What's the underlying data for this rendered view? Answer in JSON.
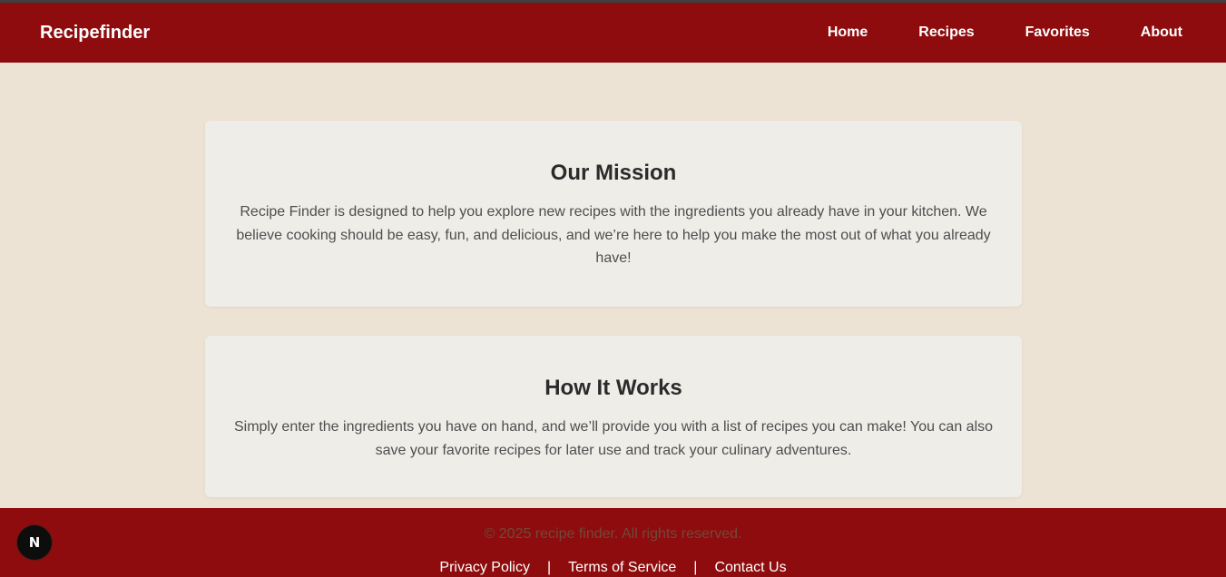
{
  "colors": {
    "nav_bg": "#8e0c0d",
    "page_bg": "#ede3d5",
    "card_bg": "#efede8",
    "heading": "#2b2b2b",
    "body_text": "#4e4e4e",
    "footer_bg": "#8e0c0d",
    "copyright_text": "#6f4a3a"
  },
  "navbar": {
    "brand": "Recipefinder",
    "links": [
      "Home",
      "Recipes",
      "Favorites",
      "About"
    ]
  },
  "mission": {
    "title": "Our Mission",
    "text": "Recipe Finder is designed to help you explore new recipes with the ingredients you already have in your kitchen. We believe cooking should be easy, fun, and delicious, and we’re here to help you make the most out of what you already have!"
  },
  "how_it_works": {
    "title": "How It Works",
    "text": "Simply enter the ingredients you have on hand, and we’ll provide you with a list of recipes you can make! You can also save your favorite recipes for later use and track your culinary adventures."
  },
  "footer": {
    "copyright": "© 2025 recipe finder. All rights reserved.",
    "links": [
      "Privacy Policy",
      "Terms of Service",
      "Contact Us"
    ],
    "separator": "|"
  },
  "badge": {
    "icon": "next-logo-icon",
    "letter": "N"
  }
}
